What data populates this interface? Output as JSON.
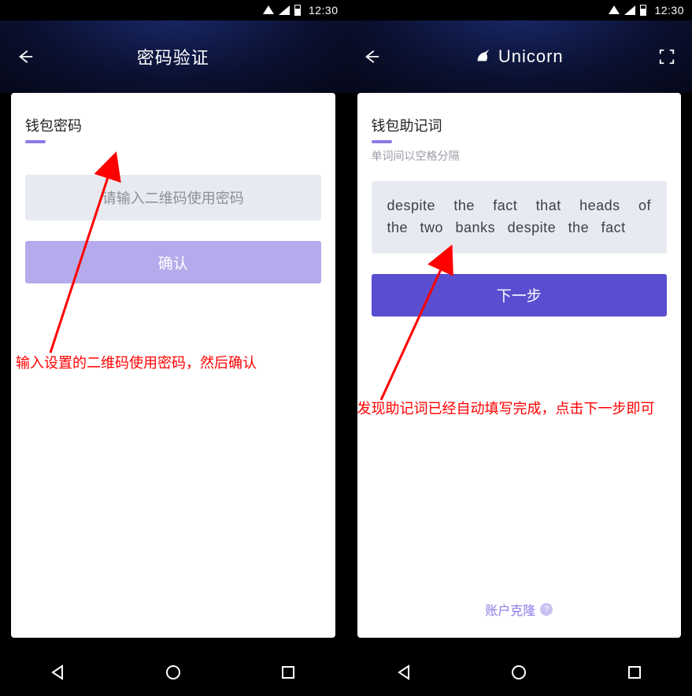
{
  "status": {
    "time": "12:30"
  },
  "left": {
    "header_title": "密码验证",
    "section_title": "钱包密码",
    "input_placeholder": "请输入二维码使用密码",
    "confirm_label": "确认",
    "annotation": "输入设置的二维码使用密码，然后确认"
  },
  "right": {
    "brand": "Unicorn",
    "section_title": "钱包助记词",
    "section_sub": "单词间以空格分隔",
    "mnemonic": "despite the fact that heads of the two banks despite the fact",
    "next_label": "下一步",
    "footer_link": "账户克隆",
    "annotation": "发现助记词已经自动填写完成，点击下一步即可"
  },
  "icons": {
    "back": "back-arrow-icon",
    "scan": "scan-icon",
    "unicorn": "unicorn-icon",
    "help": "?"
  },
  "colors": {
    "primary": "#5a4ed0",
    "primary_light": "#b5abec",
    "accent": "#8a7be8",
    "annotation": "#ff0000"
  }
}
